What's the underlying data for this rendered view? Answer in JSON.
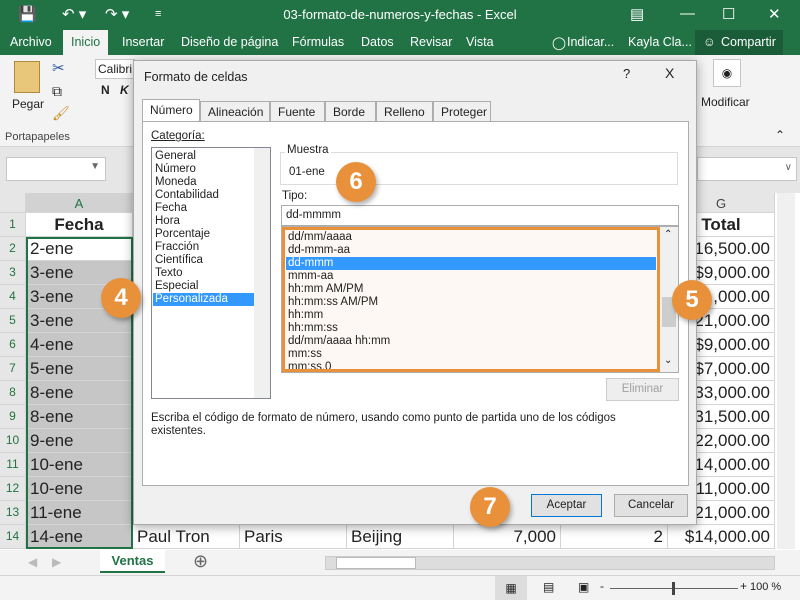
{
  "window": {
    "title": "03-formato-de-numeros-y-fechas  -  Excel"
  },
  "ribbon_tabs": [
    "Archivo",
    "Inicio",
    "Insertar",
    "Diseño de página",
    "Fórmulas",
    "Datos",
    "Revisar",
    "Vista"
  ],
  "tell_me": "Indicar...",
  "user": "Kayla Cla...",
  "share": "Compartir",
  "ribbon": {
    "paste": "Pegar",
    "clipboard_group": "Portapapeles",
    "font_name": "Calibri",
    "bold": "N",
    "italic": "K",
    "modify": "Modificar"
  },
  "columns": [
    "A",
    "G"
  ],
  "rows": [
    "1",
    "2",
    "3",
    "4",
    "5",
    "6",
    "7",
    "8",
    "9",
    "10",
    "11",
    "12",
    "13",
    "14"
  ],
  "colA": [
    "Fecha",
    "2-ene",
    "3-ene",
    "3-ene",
    "3-ene",
    "4-ene",
    "5-ene",
    "8-ene",
    "8-ene",
    "9-ene",
    "10-ene",
    "10-ene",
    "11-ene",
    "14-ene"
  ],
  "colG": [
    "Total",
    "$16,500.00",
    "$9,000.00",
    ",000.00",
    "$21,000.00",
    "$9,000.00",
    "$7,000.00",
    "$33,000.00",
    "$31,500.00",
    "$22,000.00",
    "$14,000.00",
    "$11,000.00",
    "$21,000.00",
    "$14,000.00"
  ],
  "row14": [
    "Paul Tron",
    "Paris",
    "Beijing",
    "7,000",
    "2"
  ],
  "dialog": {
    "title": "Formato de celdas",
    "help": "?",
    "close": "X",
    "tabs": [
      "Número",
      "Alineación",
      "Fuente",
      "Borde",
      "Relleno",
      "Proteger"
    ],
    "category_label": "Categoría:",
    "categories": [
      "General",
      "Número",
      "Moneda",
      "Contabilidad",
      "Fecha",
      "Hora",
      "Porcentaje",
      "Fracción",
      "Científica",
      "Texto",
      "Especial",
      "Personalizada"
    ],
    "selected_category": "Personalizada",
    "sample_label": "Muestra",
    "sample_value": "01-ene",
    "type_label": "Tipo:",
    "type_value": "dd-mmmm",
    "types": [
      "dd/mm/aaaa",
      "dd-mmm-aa",
      "dd-mmm",
      "mmm-aa",
      "hh:mm AM/PM",
      "hh:mm:ss AM/PM",
      "hh:mm",
      "hh:mm:ss",
      "dd/mm/aaaa hh:mm",
      "mm:ss",
      "mm:ss.0"
    ],
    "selected_type": "dd-mmm",
    "delete": "Eliminar",
    "help_text": "Escriba el código de formato de número, usando como punto de partida uno de los códigos existentes.",
    "ok": "Aceptar",
    "cancel": "Cancelar"
  },
  "badges": [
    "4",
    "5",
    "6",
    "7"
  ],
  "sheet_tab": "Ventas",
  "zoom": "100 %",
  "colors": {
    "excel_green": "#217346",
    "highlight": "#3399ff",
    "callout": "#e8903a"
  }
}
